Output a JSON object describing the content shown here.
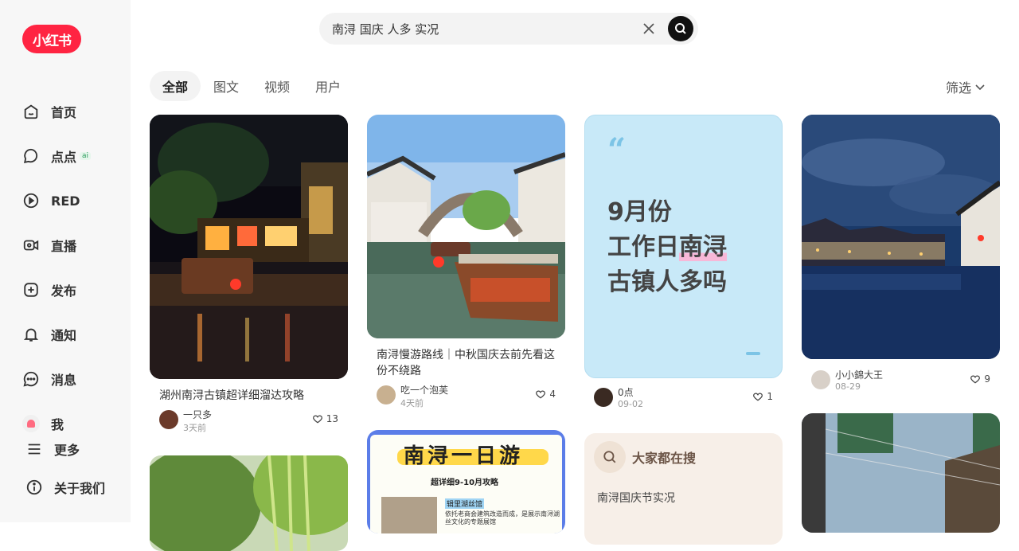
{
  "app": {
    "logo_text": "小红书",
    "brand_color": "#ff2442"
  },
  "sidebar": {
    "items": [
      {
        "label": "首页",
        "icon": "home-icon"
      },
      {
        "label": "点点",
        "icon": "chat-bubble-icon",
        "badge": "ai"
      },
      {
        "label": "RED",
        "icon": "play-icon"
      },
      {
        "label": "直播",
        "icon": "live-camera-icon"
      },
      {
        "label": "发布",
        "icon": "plus-square-icon"
      },
      {
        "label": "通知",
        "icon": "bell-icon"
      },
      {
        "label": "消息",
        "icon": "message-dots-icon"
      },
      {
        "label": "我",
        "icon": "avatar-icon"
      }
    ],
    "more_label": "更多",
    "about_label": "关于我们"
  },
  "search": {
    "query": "南浔 国庆 人多 实况"
  },
  "tabs": [
    "全部",
    "图文",
    "视频",
    "用户"
  ],
  "filter_label": "筛选",
  "cards": [
    {
      "title": "湖州南浔古镇超详细溜达攻略",
      "author": "一只多",
      "date": "3天前",
      "likes": "13"
    },
    {
      "title": "南浔慢游路线｜中秋国庆去前先看这份不绕路",
      "author": "吃一个泡芙",
      "date": "4天前",
      "likes": "4"
    },
    {
      "quote_lines": [
        "9月份",
        "工作日",
        "南浔",
        "古镇人多吗"
      ],
      "author": "0点",
      "date": "09-02",
      "likes": "1"
    },
    {
      "author": "小小錦大王",
      "date": "08-29",
      "likes": "9"
    }
  ],
  "poster": {
    "title": "南浔一日游",
    "subtitle": "超详细9-10月攻略",
    "tag": "辑里湖丝馆",
    "desc": "依托老商会建筑改造而成，是展示南浔湖丝文化的专题展馆"
  },
  "suggest": {
    "title": "大家都在搜",
    "item": "南浔国庆节实况"
  }
}
